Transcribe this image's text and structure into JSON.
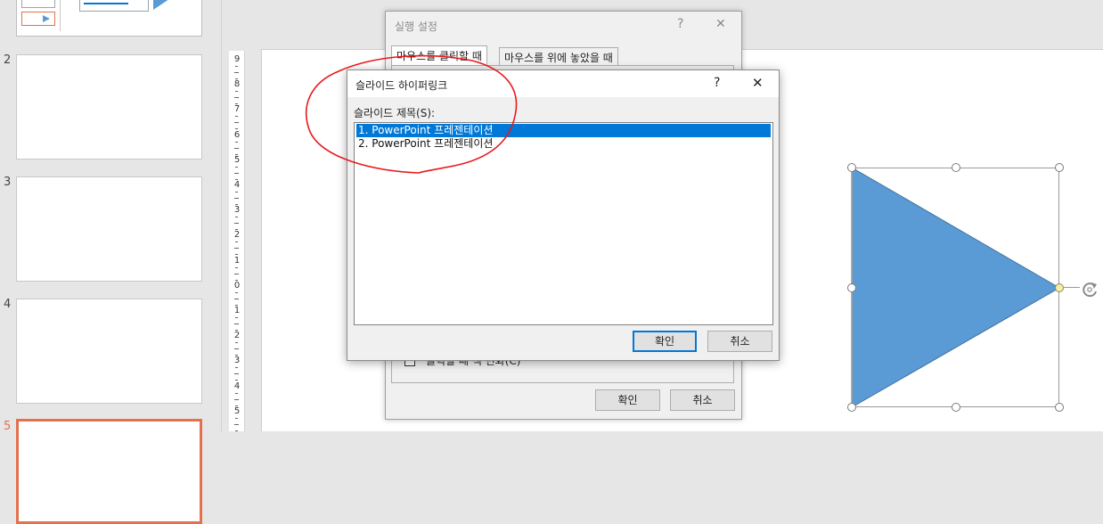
{
  "thumbnails": [
    {
      "number": ""
    },
    {
      "number": "2"
    },
    {
      "number": "3"
    },
    {
      "number": "4"
    },
    {
      "number": "5"
    }
  ],
  "ruler": {
    "labels": [
      "9",
      "8",
      "7",
      "6",
      "5",
      "4",
      "3",
      "2",
      "1",
      "0",
      "1",
      "2",
      "3",
      "4",
      "5"
    ]
  },
  "action_dialog": {
    "title": "실행 설정",
    "help": "?",
    "close": "✕",
    "tabs": [
      {
        "label": "마우스를 클릭할 때"
      },
      {
        "label": "마우스를 위에 놓았을 때"
      }
    ],
    "checkbox_label": "클릭할 때 색 변화(C)",
    "ok_label": "확인",
    "cancel_label": "취소"
  },
  "link_dialog": {
    "title": "슬라이드 하이퍼링크",
    "help": "?",
    "close": "✕",
    "list_label": "슬라이드 제목(S):",
    "items": [
      {
        "label": "1. PowerPoint 프레젠테이션",
        "selected": true
      },
      {
        "label": "2. PowerPoint 프레젠테이션",
        "selected": false
      }
    ],
    "ok_label": "확인",
    "cancel_label": "취소"
  },
  "shape": {
    "kind": "triangle-right",
    "fill": "#5b9bd5",
    "stroke": "#41719c"
  },
  "colors": {
    "accent": "#0078d7",
    "current_slide_border": "#e4704e",
    "annotation": "#e8191c"
  }
}
